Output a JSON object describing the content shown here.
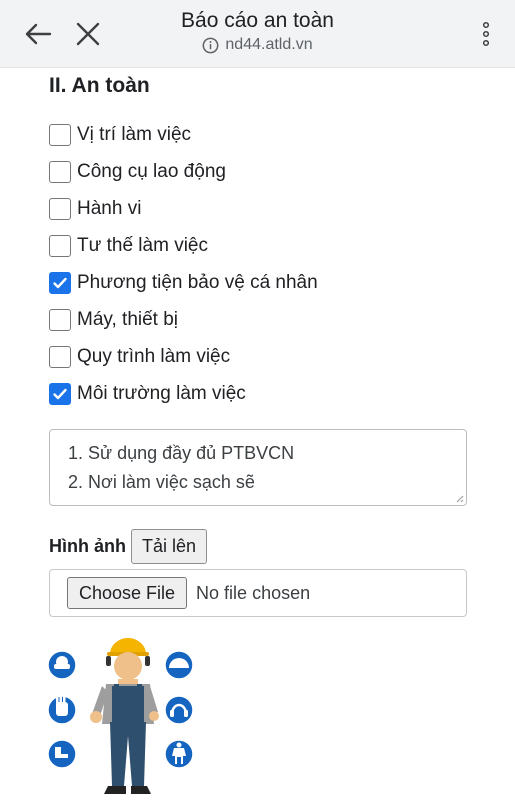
{
  "browser": {
    "title": "Báo cáo an toàn",
    "url": "nd44.atld.vn"
  },
  "section": {
    "heading": "II. An toàn"
  },
  "checklist": [
    {
      "label": "Vị trí làm việc",
      "checked": false
    },
    {
      "label": "Công cụ lao động",
      "checked": false
    },
    {
      "label": "Hành vi",
      "checked": false
    },
    {
      "label": "Tư thế làm việc",
      "checked": false
    },
    {
      "label": "Phương tiện bảo vệ cá nhân",
      "checked": true
    },
    {
      "label": "Máy, thiết bị",
      "checked": false
    },
    {
      "label": "Quy trình làm việc",
      "checked": false
    },
    {
      "label": "Môi trường làm việc",
      "checked": true
    }
  ],
  "notes": {
    "lines": [
      "1. Sử dụng đầy đủ PTBVCN",
      "2. Nơi làm việc sạch sẽ"
    ]
  },
  "image": {
    "label": "Hình ảnh",
    "upload_label": "Tải lên",
    "choose_label": "Choose File",
    "no_file_text": "No file chosen"
  },
  "colors": {
    "accent": "#1a73e8",
    "ppe_blue": "#1565c0"
  }
}
